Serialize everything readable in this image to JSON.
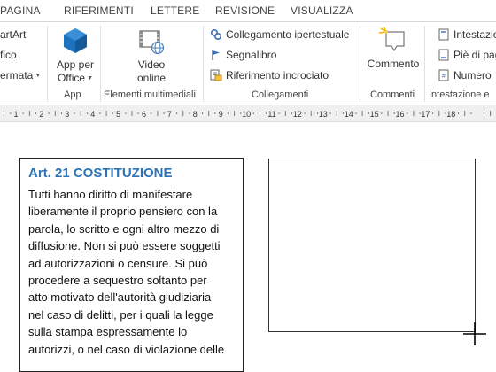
{
  "tabs": [
    {
      "label": "PAGINA"
    },
    {
      "label": "RIFERIMENTI"
    },
    {
      "label": "LETTERE"
    },
    {
      "label": "REVISIONE"
    },
    {
      "label": "VISUALIZZA"
    }
  ],
  "ribbon": {
    "partial_left": {
      "items": [
        "artArt",
        "fico",
        "ermata"
      ]
    },
    "app": {
      "button_label_line1": "App per",
      "button_label_line2": "Office",
      "group_label": "App"
    },
    "media": {
      "button_label_line1": "Video",
      "button_label_line2": "online",
      "group_label": "Elementi multimediali"
    },
    "links": {
      "items": [
        "Collegamento ipertestuale",
        "Segnalibro",
        "Riferimento incrociato"
      ],
      "group_label": "Collegamenti"
    },
    "comments": {
      "button_label": "Commento",
      "group_label": "Commenti"
    },
    "header_footer": {
      "items": [
        "Intestazio",
        "Piè di pag",
        "Numero"
      ],
      "group_label": "Intestazione e"
    }
  },
  "ruler": {
    "numbers": [
      "1",
      "2",
      "3",
      "4",
      "5",
      "6",
      "7",
      "8",
      "9",
      "10",
      "11",
      "12",
      "13",
      "14",
      "15",
      "16",
      "17",
      "18"
    ]
  },
  "document": {
    "textbox": {
      "title": "Art. 21 COSTITUZIONE",
      "lines": [
        "Tutti hanno diritto di manifestare",
        "liberamente il proprio pensiero con la",
        "parola, lo scritto e ogni altro mezzo di",
        "diffusione. Non si può essere soggetti",
        "ad autorizzazioni o censure. Si può",
        "procedere a sequestro soltanto per",
        "atto motivato dell'autorità giudiziaria",
        "nel caso di delitti, per i quali la legge",
        "sulla stampa espressamente lo",
        "autorizzi, o nel caso di violazione delle"
      ]
    }
  },
  "colors": {
    "title_blue": "#2e74b5",
    "app_icon_blue": "#1e73be",
    "ribbon_bg": "#ffffff",
    "ruler_bg": "#f0f0f0"
  },
  "icons": {
    "app_for_office": "app-for-office-icon",
    "online_video": "online-video-icon",
    "hyperlink": "hyperlink-icon",
    "bookmark": "bookmark-icon",
    "cross_reference": "cross-reference-icon",
    "comment": "comment-icon",
    "header": "header-icon",
    "footer": "footer-icon",
    "page_number": "page-number-icon",
    "crosshair": "crosshair-cursor-icon"
  }
}
